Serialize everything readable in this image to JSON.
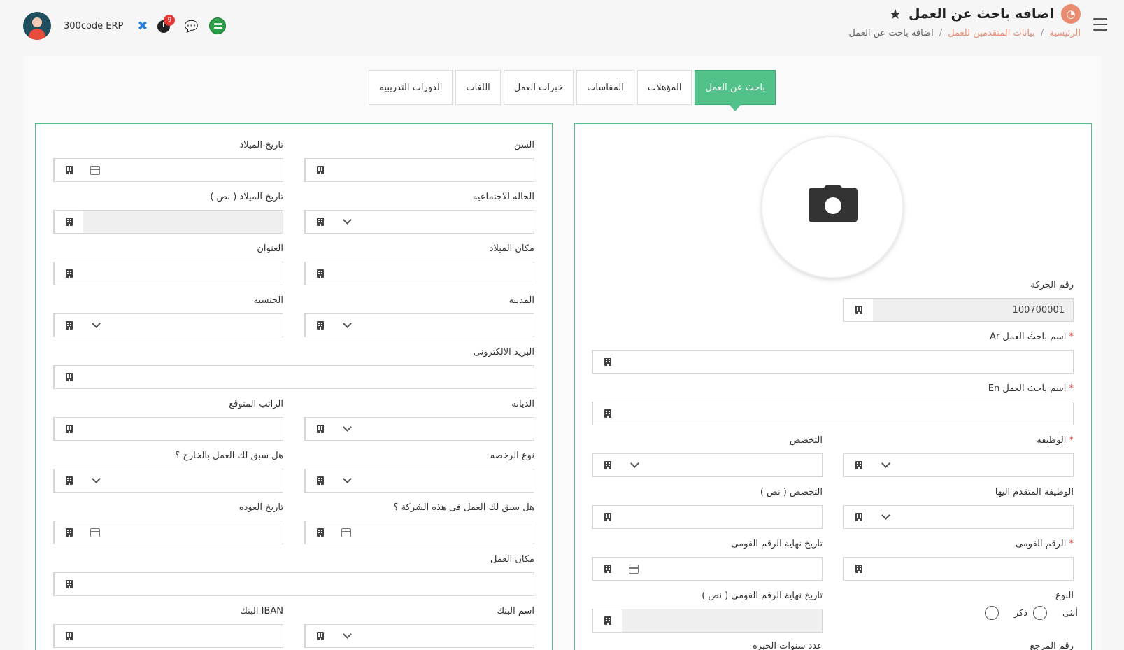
{
  "header": {
    "title": "اضافه باحث عن العمل",
    "breadcrumb": {
      "home": "الرئيسية",
      "parent": "بيانات المتقدمين للعمل",
      "current": "اضافه باحث عن العمل"
    },
    "brand": "300code ERP",
    "notification_count": "9"
  },
  "tabs": [
    "باحث عن العمل",
    "المؤهلات",
    "المقاسات",
    "خبرات العمل",
    "اللغات",
    "الدورات التدريبيه"
  ],
  "right_panel": {
    "movement_no_label": "رقم الحركة",
    "movement_no_value": "100700001",
    "name_ar_label": "اسم باحث العمل Ar",
    "name_en_label": "اسم باحث العمل En",
    "job_label": "الوظيفه",
    "specialization_label": "التخصص",
    "applied_job_label": "الوظيفة المتقدم اليها",
    "specialization_text_label": "التخصص ( نص )",
    "national_id_label": "الرقم القومى",
    "national_id_end_label": "تاريخ نهاية الرقم القومى",
    "gender_label": "النوع",
    "gender_male": "ذكر",
    "gender_female": "أنثى",
    "national_id_end_text_label": "تاريخ نهاية الرقم القومى ( نص )",
    "ref_no_label": "رقم المرجع",
    "experience_years_label": "عدد سنوات الخبره"
  },
  "left_panel": {
    "age_label": "السن",
    "birth_date_label": "تاريخ الميلاد",
    "marital_status_label": "الحاله الاجتماعيه",
    "birth_date_text_label": "تاريخ الميلاد ( نص )",
    "birth_place_label": "مكان الميلاد",
    "address_label": "العنوان",
    "city_label": "المدينه",
    "nationality_label": "الجنسيه",
    "email_label": "البريد الالكترونى",
    "religion_label": "الديانه",
    "expected_salary_label": "الراتب المتوقع",
    "license_type_label": "نوع الرخصه",
    "worked_abroad_label": "هل سبق لك العمل بالخارج ؟",
    "worked_here_label": "هل سبق لك العمل فى هذه الشركة ؟",
    "return_date_label": "تاريخ العوده",
    "work_place_label": "مكان العمل",
    "bank_name_label": "اسم البنك",
    "iban_label": "IBAN البنك"
  },
  "colors": {
    "accent_green": "#52c18a",
    "accent_orange": "#e98c70",
    "required_red": "#e53935"
  }
}
